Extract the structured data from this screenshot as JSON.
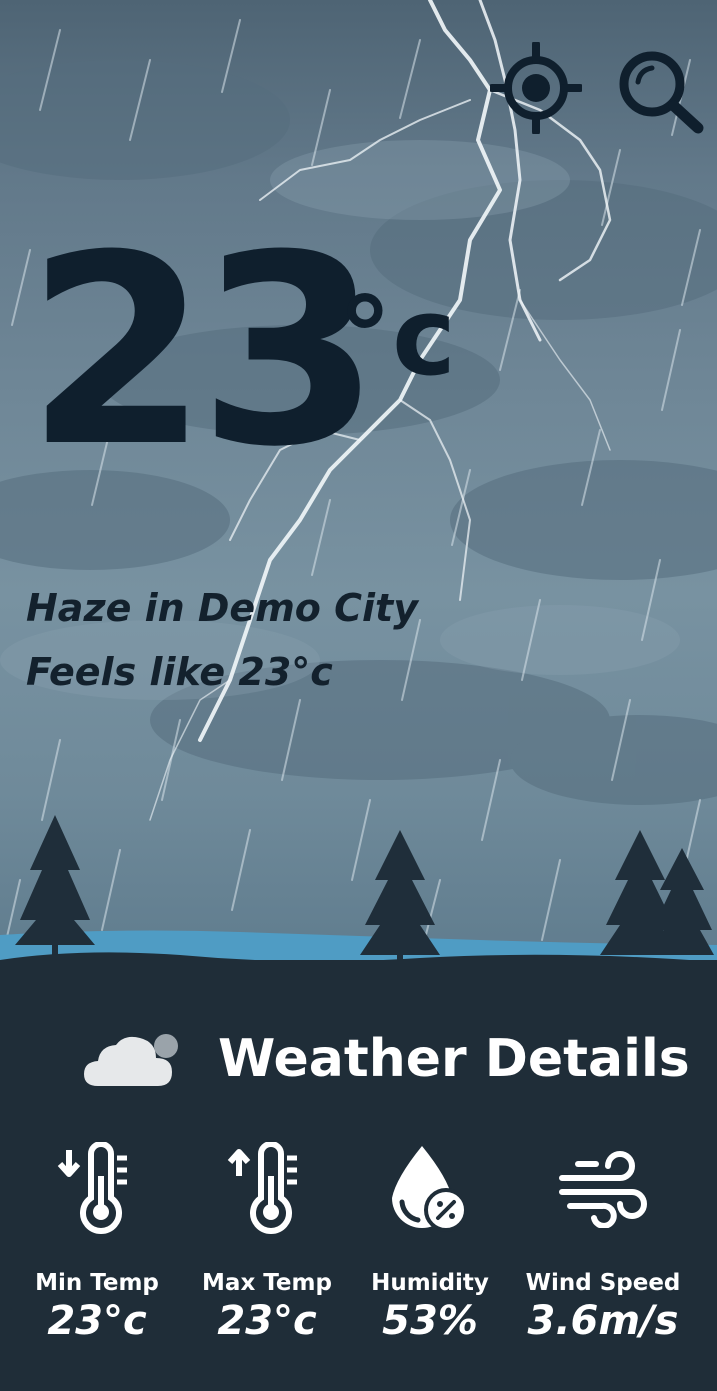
{
  "current": {
    "temperature": "23",
    "unit": "°c",
    "condition_line": "Haze in Demo City",
    "feels_like_line": "Feels like 23°c"
  },
  "toolbar": {
    "locate_icon": "crosshair-location-icon",
    "search_icon": "search-icon"
  },
  "details": {
    "title": "Weather Details",
    "title_icon": "cloud-icon",
    "stats": [
      {
        "label": "Min Temp",
        "value": "23°c",
        "icon": "thermometer-down-icon"
      },
      {
        "label": "Max Temp",
        "value": "23°c",
        "icon": "thermometer-up-icon"
      },
      {
        "label": "Humidity",
        "value": "53%",
        "icon": "humidity-drop-icon"
      },
      {
        "label": "Wind Speed",
        "value": "3.6m/s",
        "icon": "wind-icon"
      }
    ]
  },
  "colors": {
    "panel": "#1f2d38",
    "temperature_text": "#0f1f2d",
    "river": "#4f9cc4"
  }
}
